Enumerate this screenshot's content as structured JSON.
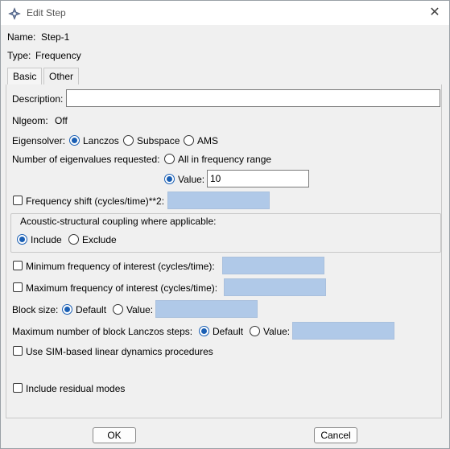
{
  "window": {
    "title": "Edit Step",
    "title_icon": "abaqus-icon",
    "close_icon": "close-icon"
  },
  "header": {
    "name_label": "Name:",
    "name_value": "Step-1",
    "type_label": "Type:",
    "type_value": "Frequency"
  },
  "tabs": [
    {
      "label": "Basic",
      "active": true
    },
    {
      "label": "Other",
      "active": false
    }
  ],
  "basic": {
    "description_label": "Description:",
    "description_value": "",
    "nlgeom_label": "Nlgeom:",
    "nlgeom_value": "Off",
    "eigensolver_label": "Eigensolver:",
    "eigensolver_options": [
      "Lanczos",
      "Subspace",
      "AMS"
    ],
    "eigensolver_selected": "Lanczos",
    "num_eigen_label": "Number of eigenvalues requested:",
    "num_eigen_all": "All in frequency range",
    "num_eigen_value_label": "Value:",
    "num_eigen_value": "10",
    "freq_shift_label": "Frequency shift (cycles/time)**2:",
    "acoustic_group_label": "Acoustic-structural coupling where applicable:",
    "acoustic_include": "Include",
    "acoustic_exclude": "Exclude",
    "min_freq_label": "Minimum frequency of interest (cycles/time):",
    "max_freq_label": "Maximum frequency of interest (cycles/time):",
    "block_size_label": "Block size:",
    "block_size_default": "Default",
    "block_size_value_label": "Value:",
    "max_block_label": "Maximum number of block Lanczos steps:",
    "max_block_default": "Default",
    "max_block_value_label": "Value:",
    "sim_label": "Use SIM-based linear dynamics procedures",
    "residual_label": "Include residual modes"
  },
  "buttons": {
    "ok": "OK",
    "cancel": "Cancel"
  },
  "colors": {
    "accent": "#1a5fb4",
    "disabled_field": "#b0c9e8"
  }
}
